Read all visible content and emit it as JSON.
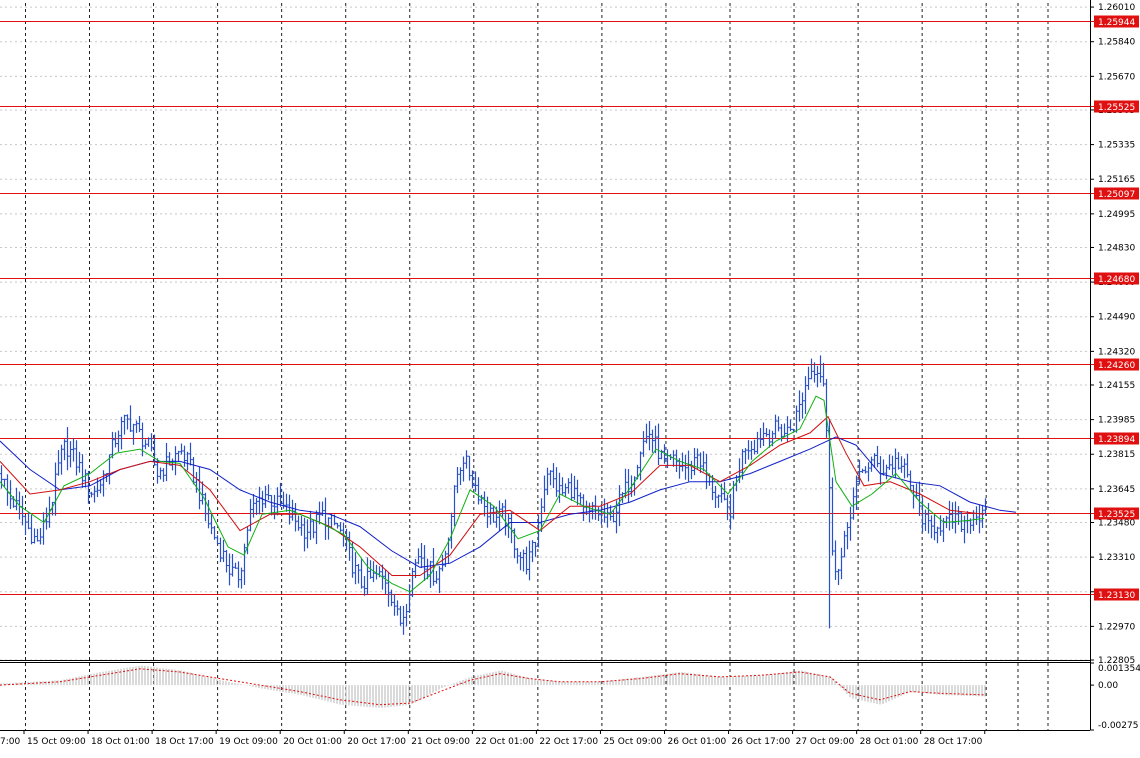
{
  "colors": {
    "background": "#ffffff",
    "grid": "#c8c8c8",
    "vgrid": "#202020",
    "level": "#e01010",
    "candle": "#2850c8",
    "ma_fast": "#10b010",
    "ma_mid": "#d01010",
    "ma_slow": "#1020c8",
    "osc_bar": "#b4b4b4",
    "osc_signal": "#e01010",
    "axis": "#000000"
  },
  "chart_data": [
    {
      "type": "line",
      "panel": "main-price",
      "subtype": "ohlc-bars",
      "grid": true,
      "ylim": [
        1.22805,
        1.2603
      ],
      "price_ticks": [
        "1.26010",
        "1.25840",
        "1.25670",
        "1.25505",
        "1.25335",
        "1.25165",
        "1.24995",
        "1.24830",
        "1.24660",
        "1.24490",
        "1.24320",
        "1.24155",
        "1.23985",
        "1.23815",
        "1.23645",
        "1.23480",
        "1.23310",
        "1.23140",
        "1.22970",
        "1.22805"
      ],
      "horizontal_levels": [
        {
          "value": 1.25944,
          "label": "1.25944"
        },
        {
          "value": 1.25525,
          "label": "1.25525"
        },
        {
          "value": 1.25097,
          "label": "1.25097"
        },
        {
          "value": 1.2468,
          "label": "1.24680"
        },
        {
          "value": 1.2426,
          "label": "1.24260"
        },
        {
          "value": 1.23894,
          "label": "1.23894"
        },
        {
          "value": 1.23525,
          "label": "1.23525"
        },
        {
          "value": 1.2313,
          "label": "1.23130"
        }
      ],
      "x_labels": [
        "7:00",
        "15 Oct 09:00",
        "18 Oct 01:00",
        "18 Oct 17:00",
        "19 Oct 09:00",
        "20 Oct 01:00",
        "20 Oct 17:00",
        "21 Oct 09:00",
        "22 Oct 01:00",
        "22 Oct 17:00",
        "25 Oct 09:00",
        "26 Oct 01:00",
        "26 Oct 17:00",
        "27 Oct 09:00",
        "28 Oct 01:00",
        "28 Oct 17:00"
      ],
      "close_path": [
        [
          0,
          1.2372
        ],
        [
          6,
          1.2362
        ],
        [
          12,
          1.2358
        ],
        [
          20,
          1.2352
        ],
        [
          28,
          1.2344
        ],
        [
          36,
          1.2338
        ],
        [
          44,
          1.2348
        ],
        [
          52,
          1.2362
        ],
        [
          58,
          1.2378
        ],
        [
          64,
          1.2386
        ],
        [
          70,
          1.2382
        ],
        [
          78,
          1.2375
        ],
        [
          86,
          1.2366
        ],
        [
          92,
          1.2362
        ],
        [
          100,
          1.2368
        ],
        [
          108,
          1.238
        ],
        [
          116,
          1.2392
        ],
        [
          124,
          1.2398
        ],
        [
          132,
          1.2396
        ],
        [
          140,
          1.239
        ],
        [
          148,
          1.2384
        ],
        [
          156,
          1.2372
        ],
        [
          164,
          1.2376
        ],
        [
          172,
          1.238
        ],
        [
          180,
          1.2383
        ],
        [
          188,
          1.2376
        ],
        [
          196,
          1.2366
        ],
        [
          204,
          1.2352
        ],
        [
          212,
          1.2342
        ],
        [
          220,
          1.2334
        ],
        [
          228,
          1.2325
        ],
        [
          236,
          1.232
        ],
        [
          242,
          1.2332
        ],
        [
          248,
          1.2352
        ],
        [
          256,
          1.2358
        ],
        [
          264,
          1.2362
        ],
        [
          272,
          1.2358
        ],
        [
          280,
          1.2356
        ],
        [
          288,
          1.2352
        ],
        [
          296,
          1.2348
        ],
        [
          304,
          1.2344
        ],
        [
          312,
          1.2346
        ],
        [
          320,
          1.2352
        ],
        [
          328,
          1.2348
        ],
        [
          336,
          1.2346
        ],
        [
          344,
          1.2338
        ],
        [
          352,
          1.2326
        ],
        [
          360,
          1.2318
        ],
        [
          368,
          1.232
        ],
        [
          376,
          1.2322
        ],
        [
          384,
          1.232
        ],
        [
          392,
          1.231
        ],
        [
          398,
          1.2298
        ],
        [
          404,
          1.2306
        ],
        [
          410,
          1.2322
        ],
        [
          418,
          1.2334
        ],
        [
          426,
          1.2326
        ],
        [
          434,
          1.2322
        ],
        [
          442,
          1.2328
        ],
        [
          450,
          1.2352
        ],
        [
          456,
          1.2372
        ],
        [
          462,
          1.238
        ],
        [
          470,
          1.237
        ],
        [
          478,
          1.2362
        ],
        [
          486,
          1.2354
        ],
        [
          494,
          1.235
        ],
        [
          502,
          1.2352
        ],
        [
          510,
          1.2342
        ],
        [
          518,
          1.2332
        ],
        [
          526,
          1.2328
        ],
        [
          534,
          1.2338
        ],
        [
          540,
          1.2358
        ],
        [
          546,
          1.2374
        ],
        [
          552,
          1.2368
        ],
        [
          560,
          1.2362
        ],
        [
          568,
          1.2366
        ],
        [
          576,
          1.236
        ],
        [
          584,
          1.235
        ],
        [
          592,
          1.2354
        ],
        [
          600,
          1.2352
        ],
        [
          608,
          1.2348
        ],
        [
          616,
          1.2356
        ],
        [
          624,
          1.2364
        ],
        [
          632,
          1.2372
        ],
        [
          640,
          1.2386
        ],
        [
          648,
          1.2392
        ],
        [
          656,
          1.2384
        ],
        [
          664,
          1.2376
        ],
        [
          672,
          1.2378
        ],
        [
          680,
          1.2376
        ],
        [
          688,
          1.2374
        ],
        [
          696,
          1.2382
        ],
        [
          704,
          1.2372
        ],
        [
          712,
          1.2364
        ],
        [
          720,
          1.2358
        ],
        [
          728,
          1.2352
        ],
        [
          736,
          1.2372
        ],
        [
          744,
          1.2386
        ],
        [
          752,
          1.2386
        ],
        [
          760,
          1.2392
        ],
        [
          768,
          1.2392
        ],
        [
          776,
          1.2394
        ],
        [
          784,
          1.2392
        ],
        [
          792,
          1.2396
        ],
        [
          800,
          1.2408
        ],
        [
          808,
          1.2422
        ],
        [
          816,
          1.2425
        ],
        [
          822,
          1.2418
        ],
        [
          826,
          1.2385
        ],
        [
          830,
          1.234
        ],
        [
          836,
          1.2322
        ],
        [
          842,
          1.2334
        ],
        [
          848,
          1.2352
        ],
        [
          854,
          1.2364
        ],
        [
          860,
          1.2372
        ],
        [
          866,
          1.2376
        ],
        [
          872,
          1.2378
        ],
        [
          880,
          1.2374
        ],
        [
          888,
          1.2376
        ],
        [
          896,
          1.2378
        ],
        [
          904,
          1.2372
        ],
        [
          912,
          1.2362
        ],
        [
          920,
          1.2352
        ],
        [
          928,
          1.2344
        ],
        [
          936,
          1.2348
        ],
        [
          944,
          1.2346
        ],
        [
          952,
          1.235
        ],
        [
          960,
          1.2348
        ],
        [
          968,
          1.235
        ],
        [
          976,
          1.2352
        ],
        [
          984,
          1.2349
        ]
      ],
      "ma_fast_path": [
        [
          0,
          1.2368
        ],
        [
          20,
          1.2356
        ],
        [
          44,
          1.2348
        ],
        [
          64,
          1.2366
        ],
        [
          90,
          1.2372
        ],
        [
          116,
          1.2382
        ],
        [
          140,
          1.2384
        ],
        [
          160,
          1.2378
        ],
        [
          180,
          1.2377
        ],
        [
          204,
          1.236
        ],
        [
          228,
          1.2336
        ],
        [
          244,
          1.2332
        ],
        [
          262,
          1.2352
        ],
        [
          290,
          1.2354
        ],
        [
          320,
          1.2348
        ],
        [
          344,
          1.2342
        ],
        [
          368,
          1.2326
        ],
        [
          392,
          1.2318
        ],
        [
          410,
          1.2314
        ],
        [
          430,
          1.2322
        ],
        [
          450,
          1.234
        ],
        [
          470,
          1.2364
        ],
        [
          494,
          1.2356
        ],
        [
          518,
          1.234
        ],
        [
          540,
          1.2344
        ],
        [
          560,
          1.2362
        ],
        [
          584,
          1.2356
        ],
        [
          610,
          1.2352
        ],
        [
          632,
          1.2366
        ],
        [
          656,
          1.2384
        ],
        [
          680,
          1.2378
        ],
        [
          704,
          1.2374
        ],
        [
          728,
          1.2362
        ],
        [
          752,
          1.2378
        ],
        [
          776,
          1.2388
        ],
        [
          800,
          1.2394
        ],
        [
          816,
          1.241
        ],
        [
          824,
          1.2408
        ],
        [
          836,
          1.2368
        ],
        [
          852,
          1.2356
        ],
        [
          872,
          1.2362
        ],
        [
          896,
          1.2372
        ],
        [
          920,
          1.2358
        ],
        [
          944,
          1.2348
        ],
        [
          968,
          1.2349
        ],
        [
          984,
          1.235
        ]
      ],
      "ma_mid_path": [
        [
          0,
          1.2378
        ],
        [
          30,
          1.2362
        ],
        [
          60,
          1.2364
        ],
        [
          90,
          1.2368
        ],
        [
          120,
          1.2374
        ],
        [
          150,
          1.2378
        ],
        [
          180,
          1.2376
        ],
        [
          210,
          1.2364
        ],
        [
          240,
          1.2344
        ],
        [
          270,
          1.2352
        ],
        [
          300,
          1.2352
        ],
        [
          330,
          1.2346
        ],
        [
          360,
          1.2336
        ],
        [
          392,
          1.2322
        ],
        [
          420,
          1.2322
        ],
        [
          450,
          1.2332
        ],
        [
          480,
          1.2352
        ],
        [
          510,
          1.2354
        ],
        [
          540,
          1.2344
        ],
        [
          570,
          1.2356
        ],
        [
          600,
          1.2356
        ],
        [
          630,
          1.2362
        ],
        [
          660,
          1.2376
        ],
        [
          690,
          1.2376
        ],
        [
          720,
          1.2368
        ],
        [
          750,
          1.2376
        ],
        [
          780,
          1.2386
        ],
        [
          810,
          1.2392
        ],
        [
          828,
          1.24
        ],
        [
          846,
          1.2382
        ],
        [
          864,
          1.2366
        ],
        [
          890,
          1.2368
        ],
        [
          920,
          1.2362
        ],
        [
          950,
          1.2354
        ],
        [
          984,
          1.2352
        ]
      ],
      "ma_slow_path": [
        [
          0,
          1.2388
        ],
        [
          30,
          1.2374
        ],
        [
          60,
          1.2364
        ],
        [
          90,
          1.2366
        ],
        [
          120,
          1.2374
        ],
        [
          150,
          1.2378
        ],
        [
          180,
          1.2378
        ],
        [
          210,
          1.2374
        ],
        [
          240,
          1.2364
        ],
        [
          270,
          1.2358
        ],
        [
          300,
          1.2354
        ],
        [
          330,
          1.2352
        ],
        [
          360,
          1.2346
        ],
        [
          392,
          1.2334
        ],
        [
          420,
          1.2326
        ],
        [
          450,
          1.2328
        ],
        [
          480,
          1.2336
        ],
        [
          510,
          1.2348
        ],
        [
          540,
          1.2348
        ],
        [
          570,
          1.2352
        ],
        [
          600,
          1.2354
        ],
        [
          630,
          1.2358
        ],
        [
          660,
          1.2364
        ],
        [
          690,
          1.2368
        ],
        [
          720,
          1.2368
        ],
        [
          750,
          1.2372
        ],
        [
          780,
          1.2378
        ],
        [
          810,
          1.2384
        ],
        [
          836,
          1.239
        ],
        [
          856,
          1.2386
        ],
        [
          880,
          1.2372
        ],
        [
          910,
          1.2368
        ],
        [
          940,
          1.2366
        ],
        [
          970,
          1.2358
        ],
        [
          1000,
          1.2354
        ],
        [
          1016,
          1.2353
        ]
      ]
    },
    {
      "type": "bar",
      "panel": "oscillator",
      "ylim": [
        -0.00275,
        0.001354
      ],
      "y_ticks": [
        "0.001354",
        "0.00",
        "-0.00275"
      ],
      "histogram": [
        [
          0,
          0.0001
        ],
        [
          60,
          0.0003
        ],
        [
          100,
          0.0008
        ],
        [
          140,
          0.0012
        ],
        [
          180,
          0.0009
        ],
        [
          220,
          0.0003
        ],
        [
          260,
          -0.0002
        ],
        [
          300,
          -0.0006
        ],
        [
          340,
          -0.0012
        ],
        [
          380,
          -0.0014
        ],
        [
          410,
          -0.0012
        ],
        [
          440,
          -0.0002
        ],
        [
          470,
          0.0005
        ],
        [
          500,
          0.0009
        ],
        [
          530,
          0.0004
        ],
        [
          560,
          0.0002
        ],
        [
          600,
          0.0002
        ],
        [
          640,
          0.0005
        ],
        [
          680,
          0.0008
        ],
        [
          720,
          0.0005
        ],
        [
          760,
          0.0006
        ],
        [
          800,
          0.0009
        ],
        [
          830,
          0.0005
        ],
        [
          850,
          -0.0008
        ],
        [
          880,
          -0.0012
        ],
        [
          910,
          -0.0004
        ],
        [
          940,
          -0.0006
        ],
        [
          985,
          -0.0007
        ]
      ],
      "signal": [
        [
          0,
          0.0
        ],
        [
          60,
          0.0002
        ],
        [
          100,
          0.0006
        ],
        [
          140,
          0.001
        ],
        [
          180,
          0.0008
        ],
        [
          220,
          0.0004
        ],
        [
          260,
          0.0
        ],
        [
          300,
          -0.0004
        ],
        [
          340,
          -0.0009
        ],
        [
          380,
          -0.0012
        ],
        [
          410,
          -0.0011
        ],
        [
          440,
          -0.0004
        ],
        [
          470,
          0.0003
        ],
        [
          500,
          0.0007
        ],
        [
          530,
          0.0004
        ],
        [
          560,
          0.0002
        ],
        [
          600,
          0.0002
        ],
        [
          640,
          0.0004
        ],
        [
          680,
          0.0007
        ],
        [
          720,
          0.0005
        ],
        [
          760,
          0.0006
        ],
        [
          800,
          0.0008
        ],
        [
          830,
          0.0005
        ],
        [
          850,
          -0.0005
        ],
        [
          880,
          -0.0009
        ],
        [
          910,
          -0.0004
        ],
        [
          940,
          -0.0005
        ],
        [
          985,
          -0.0006
        ]
      ]
    }
  ]
}
